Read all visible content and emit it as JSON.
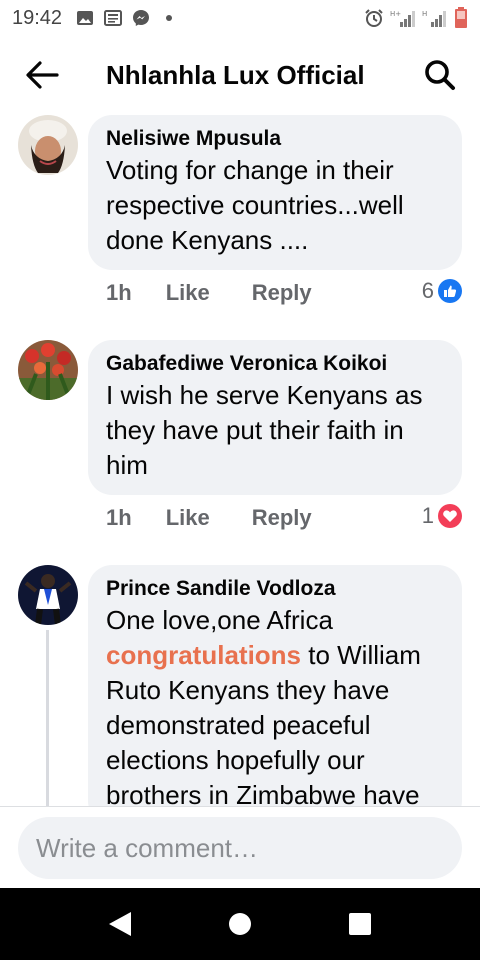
{
  "status_bar": {
    "time": "19:42",
    "left_icons": [
      "gallery-icon",
      "news-icon",
      "messenger-icon",
      "dot-icon"
    ],
    "right_icons": [
      "alarm-icon",
      "signal-h-plus-icon",
      "signal-h-icon",
      "battery-icon"
    ]
  },
  "header": {
    "title": "Nhlanhla Lux Official",
    "back_icon": "back-arrow-icon",
    "search_icon": "search-icon"
  },
  "comments": [
    {
      "author": "Nelisiwe Mpusula",
      "text": "Voting for change in their respective countries...well done Kenyans ....",
      "time": "1h",
      "like_label": "Like",
      "reply_label": "Reply",
      "reaction_count": "6",
      "reaction_type": "like-reaction-icon",
      "reaction_color": "#1877f2"
    },
    {
      "author": "Gabafediwe Veronica Koikoi",
      "text": "I wish he serve Kenyans as they have put their faith in him",
      "time": "1h",
      "like_label": "Like",
      "reply_label": "Reply",
      "reaction_count": "1",
      "reaction_type": "love-reaction-icon",
      "reaction_color": "#f33e58"
    },
    {
      "author": "Prince Sandile Vodloza",
      "text_line1": "One love,one Africa",
      "text_highlight": "congratulations",
      "text_rest": " to William Ruto Kenyans they have demonstrated peaceful elections hopefully our brothers in Zimbabwe have",
      "highlight_color": "#e8714e"
    }
  ],
  "composer": {
    "placeholder": "Write a comment…"
  },
  "nav_bar": {
    "back": "nav-back-icon",
    "home": "nav-home-icon",
    "recents": "nav-recents-icon"
  }
}
